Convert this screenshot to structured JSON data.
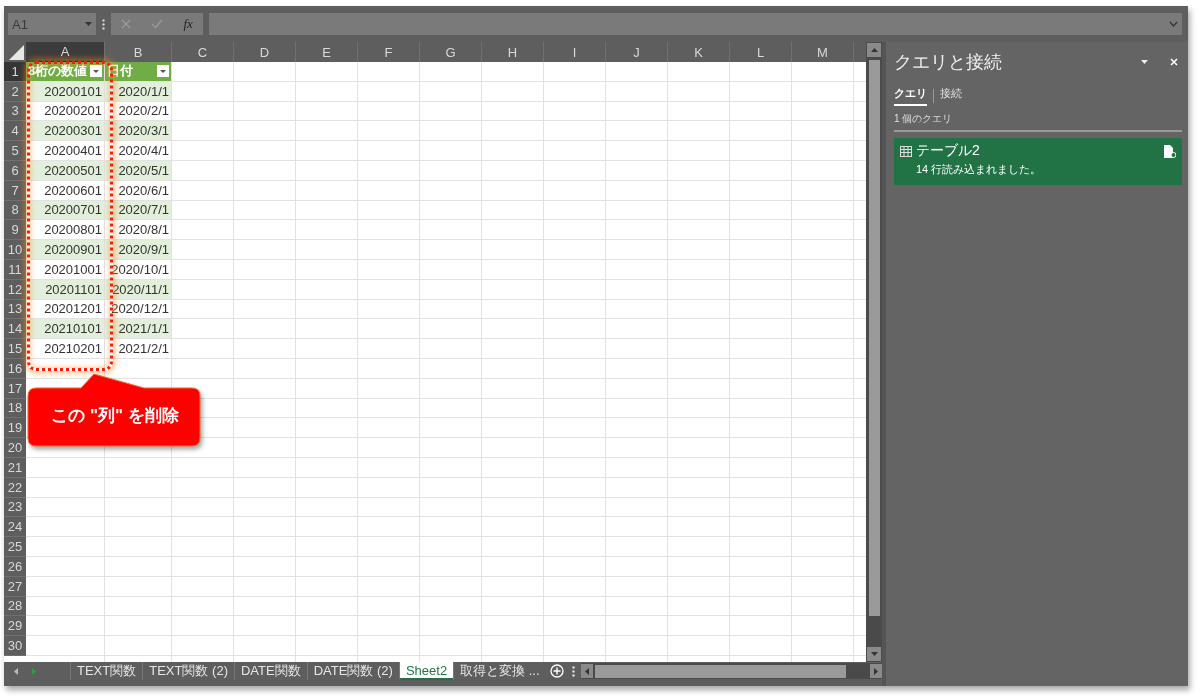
{
  "name_box": {
    "value": "A1"
  },
  "formula_bar": {
    "fx": "fx"
  },
  "columns": [
    {
      "label": "A",
      "selected": true
    },
    {
      "label": "B",
      "selected": false
    },
    {
      "label": "C",
      "selected": false
    },
    {
      "label": "D",
      "selected": false
    },
    {
      "label": "E",
      "selected": false
    },
    {
      "label": "F",
      "selected": false
    },
    {
      "label": "G",
      "selected": false
    },
    {
      "label": "H",
      "selected": false
    },
    {
      "label": "I",
      "selected": false
    },
    {
      "label": "J",
      "selected": false
    },
    {
      "label": "K",
      "selected": false
    },
    {
      "label": "L",
      "selected": false
    },
    {
      "label": "M",
      "selected": false
    }
  ],
  "row_numbers": [
    {
      "label": "1",
      "selected": true
    },
    {
      "label": "2",
      "selected": false
    },
    {
      "label": "3",
      "selected": false
    },
    {
      "label": "4",
      "selected": false
    },
    {
      "label": "5",
      "selected": false
    },
    {
      "label": "6",
      "selected": false
    },
    {
      "label": "7",
      "selected": false
    },
    {
      "label": "8",
      "selected": false
    },
    {
      "label": "9",
      "selected": false
    },
    {
      "label": "10",
      "selected": false
    },
    {
      "label": "11",
      "selected": false
    },
    {
      "label": "12",
      "selected": false
    },
    {
      "label": "13",
      "selected": false
    },
    {
      "label": "14",
      "selected": false
    },
    {
      "label": "15",
      "selected": false
    },
    {
      "label": "16",
      "selected": false
    },
    {
      "label": "17",
      "selected": false
    },
    {
      "label": "18",
      "selected": false
    },
    {
      "label": "19",
      "selected": false
    },
    {
      "label": "20",
      "selected": false
    },
    {
      "label": "21",
      "selected": false
    },
    {
      "label": "22",
      "selected": false
    },
    {
      "label": "23",
      "selected": false
    },
    {
      "label": "24",
      "selected": false
    },
    {
      "label": "25",
      "selected": false
    },
    {
      "label": "26",
      "selected": false
    },
    {
      "label": "27",
      "selected": false
    },
    {
      "label": "28",
      "selected": false
    },
    {
      "label": "29",
      "selected": false
    },
    {
      "label": "30",
      "selected": false
    }
  ],
  "table": {
    "header": [
      "8桁の数値",
      "日付"
    ],
    "rows": [
      [
        "20200101",
        "2020/1/1"
      ],
      [
        "20200201",
        "2020/2/1"
      ],
      [
        "20200301",
        "2020/3/1"
      ],
      [
        "20200401",
        "2020/4/1"
      ],
      [
        "20200501",
        "2020/5/1"
      ],
      [
        "20200601",
        "2020/6/1"
      ],
      [
        "20200701",
        "2020/7/1"
      ],
      [
        "20200801",
        "2020/8/1"
      ],
      [
        "20200901",
        "2020/9/1"
      ],
      [
        "20201001",
        "2020/10/1"
      ],
      [
        "20201101",
        "2020/11/1"
      ],
      [
        "20201201",
        "2020/12/1"
      ],
      [
        "20210101",
        "2021/1/1"
      ],
      [
        "20210201",
        "2021/2/1"
      ]
    ]
  },
  "annotation": {
    "text": "この \"列\" を削除"
  },
  "sheet_tabs": [
    {
      "label": "TEXT関数",
      "selected": false
    },
    {
      "label": "TEXT関数 (2)",
      "selected": false
    },
    {
      "label": "DATE関数",
      "selected": false
    },
    {
      "label": "DATE関数 (2)",
      "selected": false
    },
    {
      "label": "Sheet2",
      "selected": true
    },
    {
      "label": "取得と変換 ...",
      "selected": false
    }
  ],
  "panel": {
    "title": "クエリと接続",
    "tabs": [
      {
        "label": "クエリ",
        "selected": true
      },
      {
        "label": "接続",
        "selected": false
      }
    ],
    "count": "1 個のクエリ",
    "queries": [
      {
        "name": "テーブル2",
        "status": "14 行読み込まれました。",
        "selected": true
      }
    ]
  }
}
